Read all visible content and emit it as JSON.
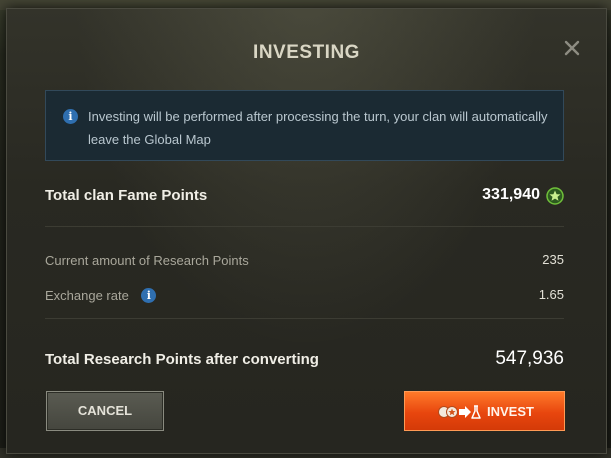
{
  "dialog": {
    "title": "INVESTING",
    "close_icon": "close-icon"
  },
  "info": {
    "icon": "info-icon",
    "text": "Investing will be performed after processing the turn, your clan will automatically leave the Global Map"
  },
  "fame": {
    "label": "Total clan Fame Points",
    "value": "331,940",
    "icon": "fame-points-icon"
  },
  "research": {
    "label": "Current amount of Research Points",
    "value": "235"
  },
  "exchange": {
    "label": "Exchange rate",
    "value": "1.65",
    "help_icon": "info-icon"
  },
  "total": {
    "label": "Total Research Points after converting",
    "value": "547,936"
  },
  "buttons": {
    "cancel_label": "CANCEL",
    "invest_label": "INVEST",
    "invest_icon": "fame-to-research-icon"
  },
  "colors": {
    "accent": "#e8460e",
    "info_blue": "#2f6fb0",
    "fame_green": "#6fbf3a"
  }
}
